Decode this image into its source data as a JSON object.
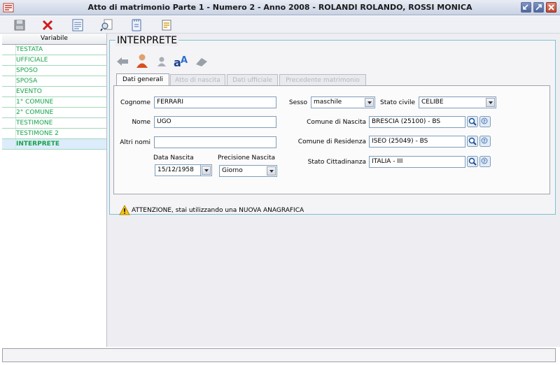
{
  "window": {
    "title": "Atto di matrimonio Parte 1  - Numero 2 - Anno 2008 - ROLANDI ROLANDO, ROSSI MONICA",
    "buttons": [
      "minimize-icon",
      "maximize-icon",
      "close-icon"
    ]
  },
  "toolbar": {
    "icons": [
      "save-icon",
      "delete-icon",
      "document-icon",
      "preview-icon",
      "notes-icon",
      "print-icon"
    ]
  },
  "sidebar": {
    "header": "Variabile",
    "items": [
      {
        "label": "TESTATA"
      },
      {
        "label": "UFFICIALE"
      },
      {
        "label": "SPOSO"
      },
      {
        "label": "SPOSA"
      },
      {
        "label": "EVENTO"
      },
      {
        "label": "1° COMUNE"
      },
      {
        "label": "2° COMUNE"
      },
      {
        "label": "TESTIMONE"
      },
      {
        "label": "TESTIMONE 2"
      },
      {
        "label": "INTERPRETE",
        "selected": true
      }
    ]
  },
  "main": {
    "section_title": "INTERPRETE",
    "icons": [
      "back-arrow-icon",
      "person-icon",
      "person-gray-icon",
      "font-icon",
      "eraser-icon"
    ],
    "tabs": [
      {
        "label": "Dati generali",
        "active": true
      },
      {
        "label": "Atto di nascita",
        "active": false
      },
      {
        "label": "Dati ufficiale",
        "active": false
      },
      {
        "label": "Precedente matrimonio",
        "active": false
      }
    ],
    "form": {
      "cognome_label": "Cognome",
      "cognome_value": "FERRARI",
      "nome_label": "Nome",
      "nome_value": "UGO",
      "altri_nomi_label": "Altri nomi",
      "altri_nomi_value": "",
      "data_nascita_label": "Data Nascita",
      "data_nascita_value": "15/12/1958",
      "precisione_label": "Precisione Nascita",
      "precisione_value": "Giorno",
      "sesso_label": "Sesso",
      "sesso_value": "maschile",
      "stato_civile_label": "Stato civile",
      "stato_civile_value": "CELIBE",
      "comune_nascita_label": "Comune di Nascita",
      "comune_nascita_value": "BRESCIA (25100) - BS",
      "comune_residenza_label": "Comune di Residenza",
      "comune_residenza_value": "ISEO (25049) - BS",
      "cittadinanza_label": "Stato Cittadinanza",
      "cittadinanza_value": "ITALIA - III"
    },
    "warning": "ATTENZIONE, stai utilizzando una NUOVA ANAGRAFICA"
  },
  "status_bar": {
    "text": ""
  },
  "colors": {
    "accent_green": "#17a34a",
    "group_border": "#79c3d2",
    "selected_row": "#dcecfc"
  }
}
